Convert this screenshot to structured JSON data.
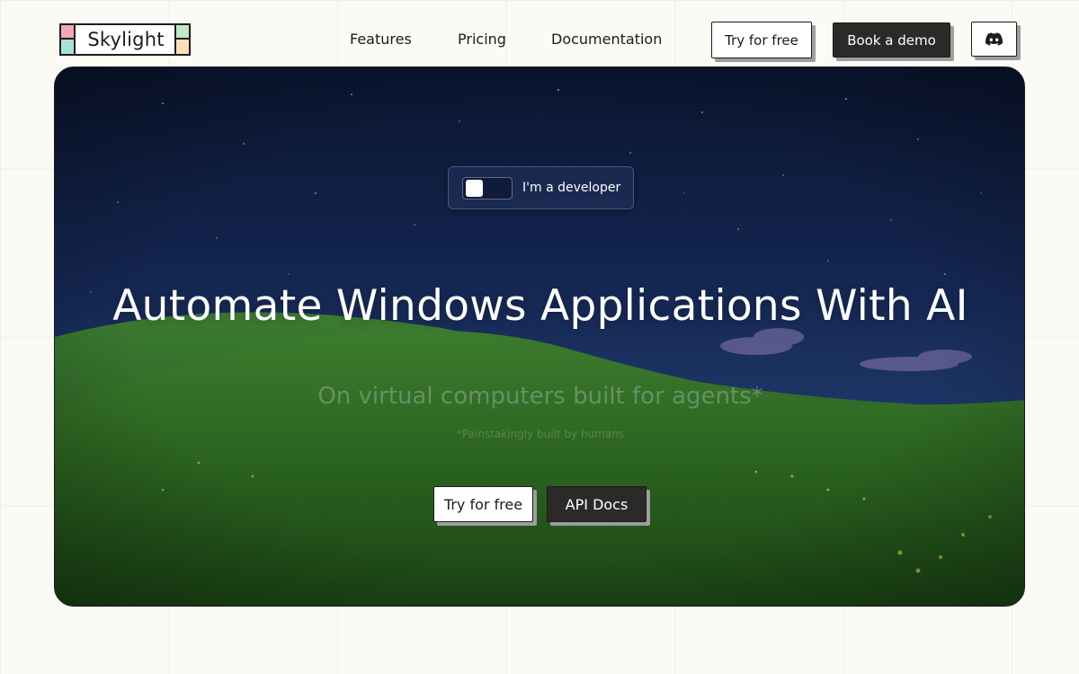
{
  "header": {
    "logo_text": "Skylight",
    "nav": {
      "features": "Features",
      "pricing": "Pricing",
      "documentation": "Documentation"
    },
    "try_label": "Try for free",
    "demo_label": "Book a demo",
    "discord_icon": "discord-icon"
  },
  "hero": {
    "toggle_label": "I'm a developer",
    "toggle_state": "off",
    "title": "Automate Windows Applications With AI",
    "subtitle": "On virtual computers built for agents*",
    "footnote": "*Painstakingly built by humans",
    "try_label": "Try for free",
    "api_label": "API Docs"
  },
  "colors": {
    "page_bg": "#fcfaf4",
    "dark_button": "#2b2a29",
    "sky": "#0d1a3a",
    "grass": "#3d7a2a"
  }
}
